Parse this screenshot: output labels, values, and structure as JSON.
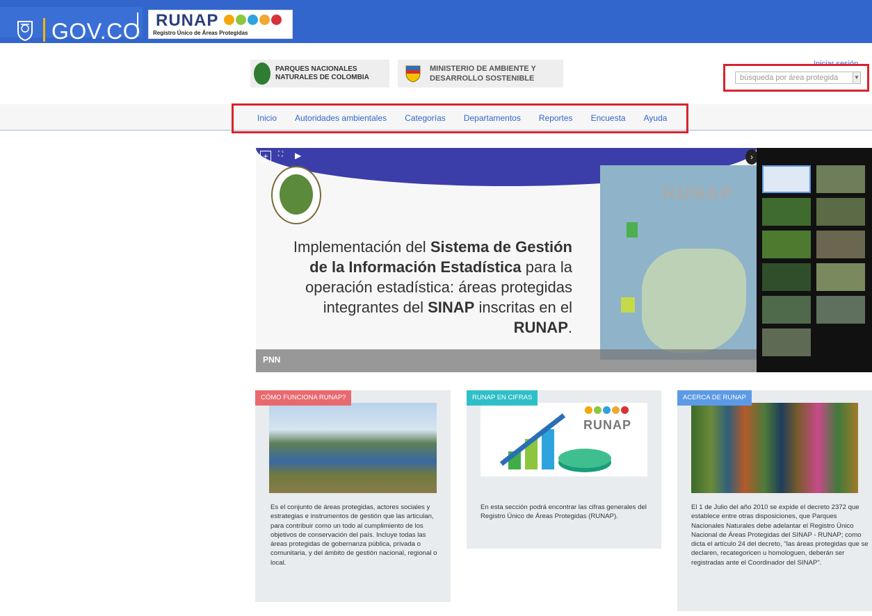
{
  "header": {
    "gov_label": "GOV.CO",
    "runap_word": "RUNAP",
    "runap_sub": "Registro Único de Áreas Protegidas",
    "dot_colors": [
      "#f4a70a",
      "#8cc63f",
      "#2ea3dc",
      "#f0a830",
      "#d8323a"
    ]
  },
  "logos": {
    "pnn_line1": "PARQUES NACIONALES",
    "pnn_line2": "NATURALES DE COLOMBIA",
    "min_line1": "MINISTERIO DE AMBIENTE Y",
    "min_line2": "DESARROLLO SOSTENIBLE"
  },
  "login": {
    "label": "Iniciar sesión"
  },
  "search": {
    "placeholder": "búsqueda por área protegida"
  },
  "nav": {
    "items": [
      "Inicio",
      "Autoridades ambientales",
      "Categorías",
      "Departamentos",
      "Reportes",
      "Encuesta",
      "Ayuda"
    ]
  },
  "slider": {
    "text_parts": [
      {
        "t": "Implementación del ",
        "b": false
      },
      {
        "t": "Sistema de Gestión de la Información Estadística",
        "b": true
      },
      {
        "t": " para la operación estadística: áreas protegidas integrantes del ",
        "b": false
      },
      {
        "t": "SINAP",
        "b": true
      },
      {
        "t": " inscritas en el ",
        "b": false
      },
      {
        "t": "RUNAP",
        "b": true
      },
      {
        "t": ".",
        "b": false
      }
    ],
    "caption": "PNN",
    "runap_word": "RUNAP",
    "plus_label": "+",
    "fullscreen_label": "⛶",
    "play_label": "▶",
    "next_label": "›"
  },
  "cards": [
    {
      "tag": "CÓMO FUNCIONA RUNAP?",
      "tag_color": "#e86a6f",
      "text": "Es el conjunto de áreas protegidas, actores sociales y estrategias e instrumentos de gestión que las articulan, para contribuir como un todo al cumplimiento de los objetivos de conservación del país. Incluye todas las áreas protegidas de gobernanza pública, privada o comunitaria, y del ámbito de gestión nacional, regional o local."
    },
    {
      "tag": "RUNAP EN CIFRAS",
      "tag_color": "#2ebfc8",
      "text": "En esta sección podrá encontrar las cifras generales del Registro Único de Áreas Protegidas (RUNAP)."
    },
    {
      "tag": "ACERCA DE RUNAP",
      "tag_color": "#5c9ae6",
      "text": "El 1 de Julio del año 2010 se expide el decreto 2372 que establece entre otras disposiciones, que Parques Nacionales Naturales debe adelantar el Registro Único Nacional de Áreas Protegidas del SINAP - RUNAP; como dicta el artículo 24 del decreto, \"las áreas protegidas que se declaren, recategoricen u homologuen, deberán ser registradas ante el Coordinador del SINAP\"."
    }
  ],
  "card_runap_word": "RUNAP"
}
